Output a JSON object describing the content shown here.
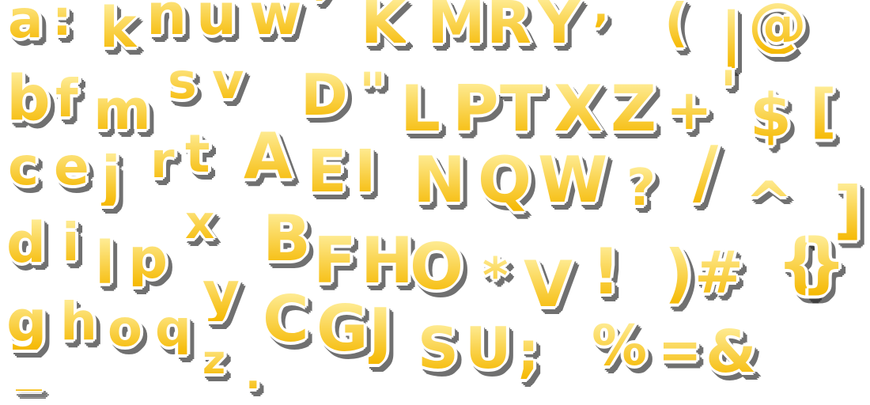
{
  "colors": {
    "fill_top": "#FFF0A0",
    "fill_bottom": "#F5B800",
    "outline": "#FFFFFF",
    "shadow": "#333333",
    "background": "#FFFFFF"
  },
  "glyphs": [
    "a",
    ":",
    "k",
    "n",
    "u",
    "w",
    "’",
    "K",
    "M",
    "R",
    "Y",
    "¯",
    ",",
    "(",
    "|",
    "@",
    "b",
    "f",
    "m",
    "s",
    "v",
    "D",
    "\"",
    "L",
    "P",
    "T",
    "X",
    "Z",
    "+",
    "'",
    "$",
    "[",
    "c",
    "e",
    "j",
    "r",
    "t",
    "A",
    "E",
    "I",
    "N",
    "Q",
    "W",
    "?",
    "/",
    "^",
    "]",
    "d",
    "i",
    "l",
    "p",
    "x",
    "B",
    "F",
    "H",
    "O",
    "*",
    "V",
    "!",
    ")",
    "#",
    "{",
    "}",
    "g",
    "h",
    "o",
    "q",
    "y",
    "z",
    ".",
    "C",
    "G",
    "J",
    "S",
    "U",
    ";",
    "%",
    "=",
    "&",
    "_"
  ]
}
